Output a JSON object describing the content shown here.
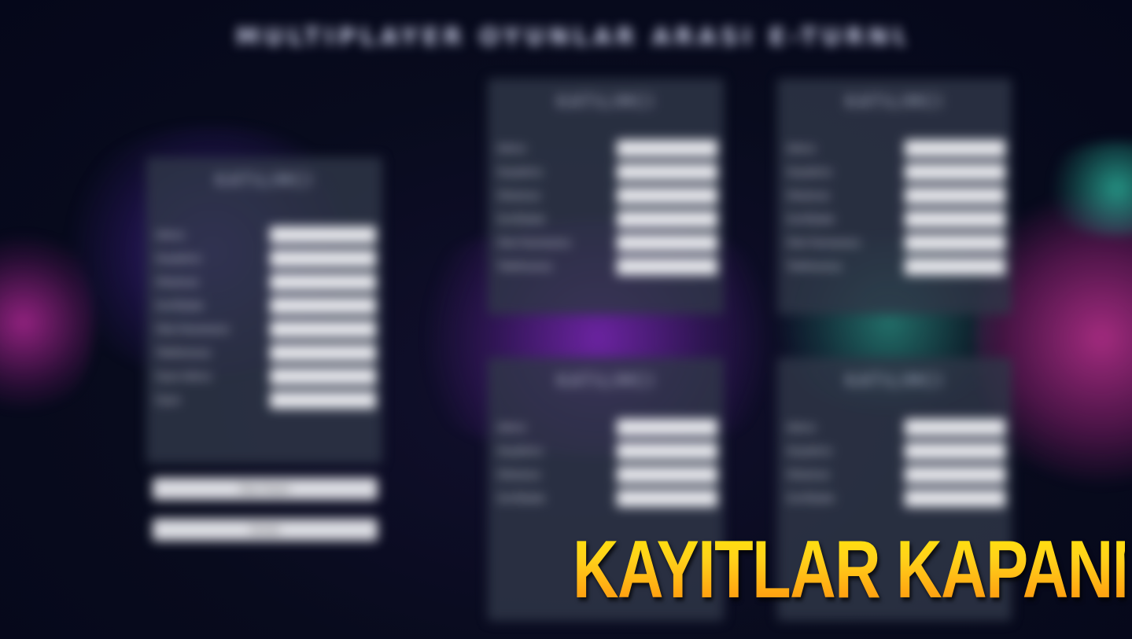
{
  "banner": {
    "text": "KAYITLAR KAPANMIŞTIR",
    "gradient_top": "#fff200",
    "gradient_bottom": "#ff6a00"
  },
  "background": {
    "heading": "MULTIPLAYER OYUNLAR ARASI E-TURNUVA",
    "panel_title": "KATILIMCI",
    "panels": [
      {
        "labels": [
          "Adınız",
          "Soyadınız",
          "Okulunuz",
          "Sınıf/Şube",
          "Okul Numaranız",
          "Telefonunuz",
          "Oyun Adınız",
          "Oyun"
        ],
        "buttons": [
          "Ekip Oluştur",
          "Gönder"
        ]
      },
      {
        "labels": [
          "Adınız",
          "Soyadınız",
          "Okulunuz",
          "Sınıf/Şube",
          "Okul Numaranız",
          "Telefonunuz"
        ]
      },
      {
        "labels": [
          "Adınız",
          "Soyadınız",
          "Okulunuz",
          "Sınıf/Şube",
          "Okul Numaranız",
          "Telefonunuz"
        ]
      },
      {
        "labels": [
          "Adınız",
          "Soyadınız",
          "Okulunuz",
          "Sınıf/Şube"
        ]
      },
      {
        "labels": [
          "Adınız",
          "Soyadınız",
          "Okulunuz",
          "Sınıf/Şube"
        ]
      }
    ],
    "colors": {
      "bg": "#070a1c",
      "panel": "#303748",
      "accent_purple": "#7a2bd0",
      "accent_pink": "#e03fb8",
      "accent_teal": "#2fbfa5"
    }
  }
}
